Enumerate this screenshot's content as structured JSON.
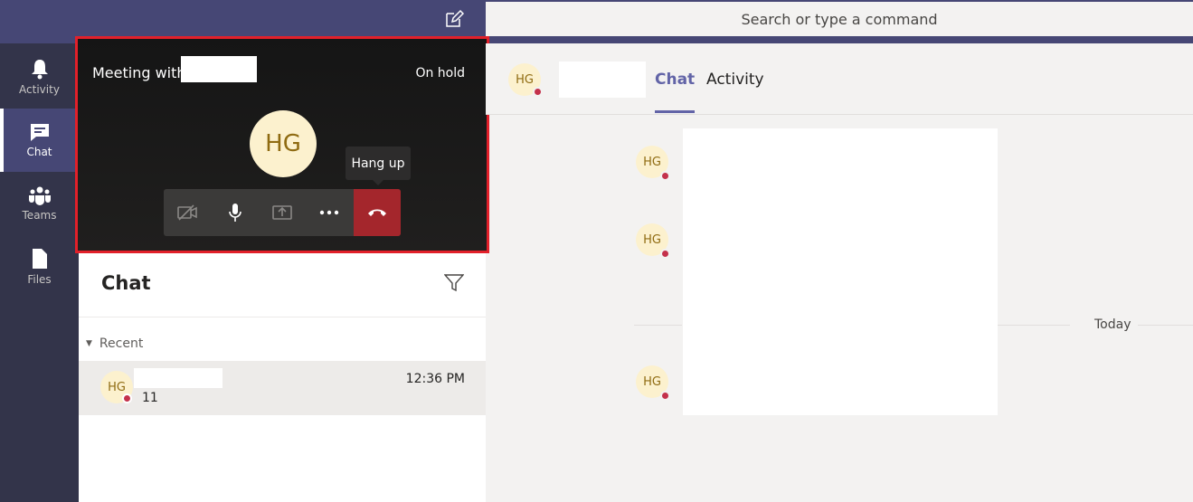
{
  "search": {
    "placeholder": "Search or type a command"
  },
  "rail": {
    "items": [
      {
        "label": "Activity",
        "icon": "bell-icon",
        "active": false
      },
      {
        "label": "Chat",
        "icon": "chat-icon",
        "active": true
      },
      {
        "label": "Teams",
        "icon": "teams-icon",
        "active": false
      },
      {
        "label": "Files",
        "icon": "file-icon",
        "active": false
      }
    ]
  },
  "meeting": {
    "title": "Meeting with",
    "status": "On hold",
    "avatar_initials": "HG",
    "tooltip": "Hang up",
    "controls": [
      "video-off-icon",
      "microphone-icon",
      "share-screen-icon",
      "more-icon",
      "hang-up-icon"
    ]
  },
  "chat_list": {
    "heading": "Chat",
    "section": "Recent",
    "rows": [
      {
        "initials": "HG",
        "time": "12:36 PM",
        "preview": "11"
      }
    ]
  },
  "conversation": {
    "header_initials": "HG",
    "tabs": [
      {
        "label": "Chat",
        "active": true
      },
      {
        "label": "Activity",
        "active": false
      }
    ],
    "messages": [
      {
        "initials": "HG"
      },
      {
        "initials": "HG"
      },
      {
        "initials": "HG"
      }
    ],
    "date_divider": "Today"
  },
  "colors": {
    "brand": "#464775",
    "rail": "#33344a",
    "accent": "#6264a7",
    "hangup": "#a4262c",
    "highlight_border": "#e2202a",
    "avatar_bg": "#fcf1ce",
    "status_busy": "#c4314b"
  }
}
